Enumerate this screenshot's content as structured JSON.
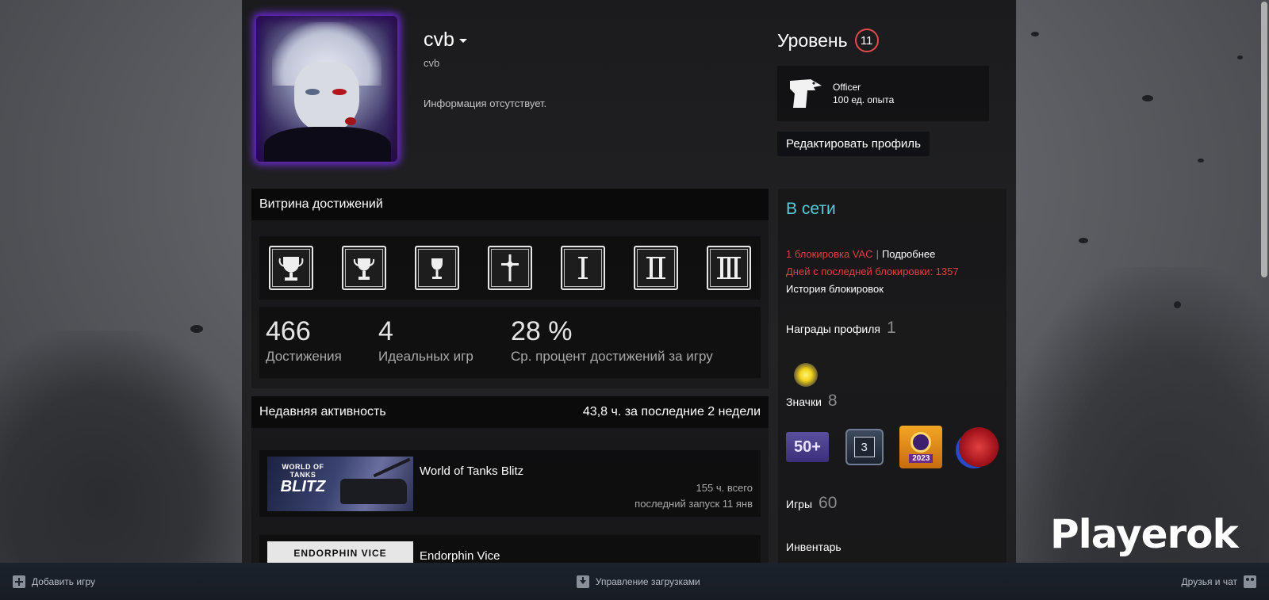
{
  "profile": {
    "persona_name": "cvb",
    "real_name": "cvb",
    "summary": "Информация отсутствует.",
    "level_label": "Уровень",
    "level": "11",
    "badge_name": "Officer",
    "badge_xp": "100 ед. опыта",
    "edit_button": "Редактировать профиль"
  },
  "showcase": {
    "title": "Витрина достижений",
    "icons": [
      "trophy-large-icon",
      "trophy-medium-icon",
      "trophy-small-icon",
      "cross-icon",
      "rank-one-icon",
      "rank-two-icon",
      "rank-three-icon"
    ],
    "stats": [
      {
        "value": "466",
        "label": "Достижения"
      },
      {
        "value": "4",
        "label": "Идеальных игр"
      },
      {
        "value": "28 %",
        "label": "Ср. процент достижений за игру"
      }
    ]
  },
  "activity": {
    "title": "Недавняя активность",
    "hours_summary": "43,8 ч. за последние 2 недели",
    "games": [
      {
        "name": "World of Tanks Blitz",
        "hours": "155 ч. всего",
        "last_played": "последний запуск 11 янв",
        "capsule_line1": "WORLD OF TANKS",
        "capsule_line2": "BLITZ"
      },
      {
        "name": "Endorphin Vice",
        "capsule_text": "ENDORPHIN VICE"
      }
    ]
  },
  "sidebar": {
    "status": "В сети",
    "vac_line": "1 блокировка VAC",
    "vac_separator": "|",
    "vac_more": "Подробнее",
    "days_since_ban": "Дней с последней блокировки: 1357",
    "ban_history": "История блокировок",
    "awards_label": "Награды профиля",
    "awards_count": "1",
    "badges_label": "Значки",
    "badges_count": "8",
    "badge_50": "50+",
    "badge_3": "3",
    "badge_2023": "2023",
    "games_label": "Игры",
    "games_count": "60",
    "inventory_label": "Инвентарь"
  },
  "watermark": "Playerok",
  "bottombar": {
    "add_game": "Добавить игру",
    "downloads": "Управление загрузками",
    "friends": "Друзья и чат"
  },
  "colors": {
    "status_online": "#57cbde",
    "vac_red": "#d94141",
    "level_ring": "#e04b4b",
    "avatar_glow": "#6b2bd1"
  }
}
